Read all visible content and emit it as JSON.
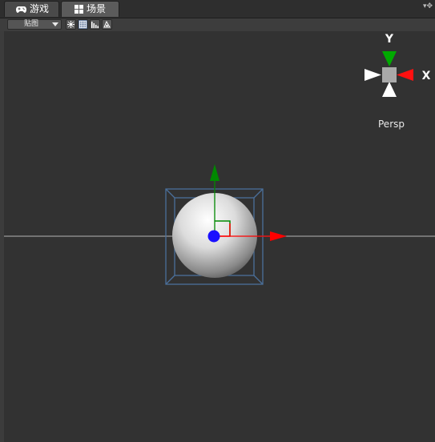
{
  "tabs": [
    {
      "label": "游戏",
      "icon": "gamepad-icon"
    },
    {
      "label": "场景",
      "icon": "grid-icon"
    }
  ],
  "panel_menu": {
    "icon": "panel-options-icon"
  },
  "toolbar": {
    "render_mode": "贴图",
    "buttons": [
      "lighting-toggle-icon",
      "grid-toggle-icon",
      "stats-icon",
      "gizmo-icon"
    ]
  },
  "orientation_gizmo": {
    "y_label": "Y",
    "x_label": "X",
    "projection": "Persp"
  },
  "colors": {
    "x_axis": "#ff0000",
    "y_axis": "#008800",
    "z_axis": "#1a10ff",
    "bounds": "#4a6f9a"
  }
}
